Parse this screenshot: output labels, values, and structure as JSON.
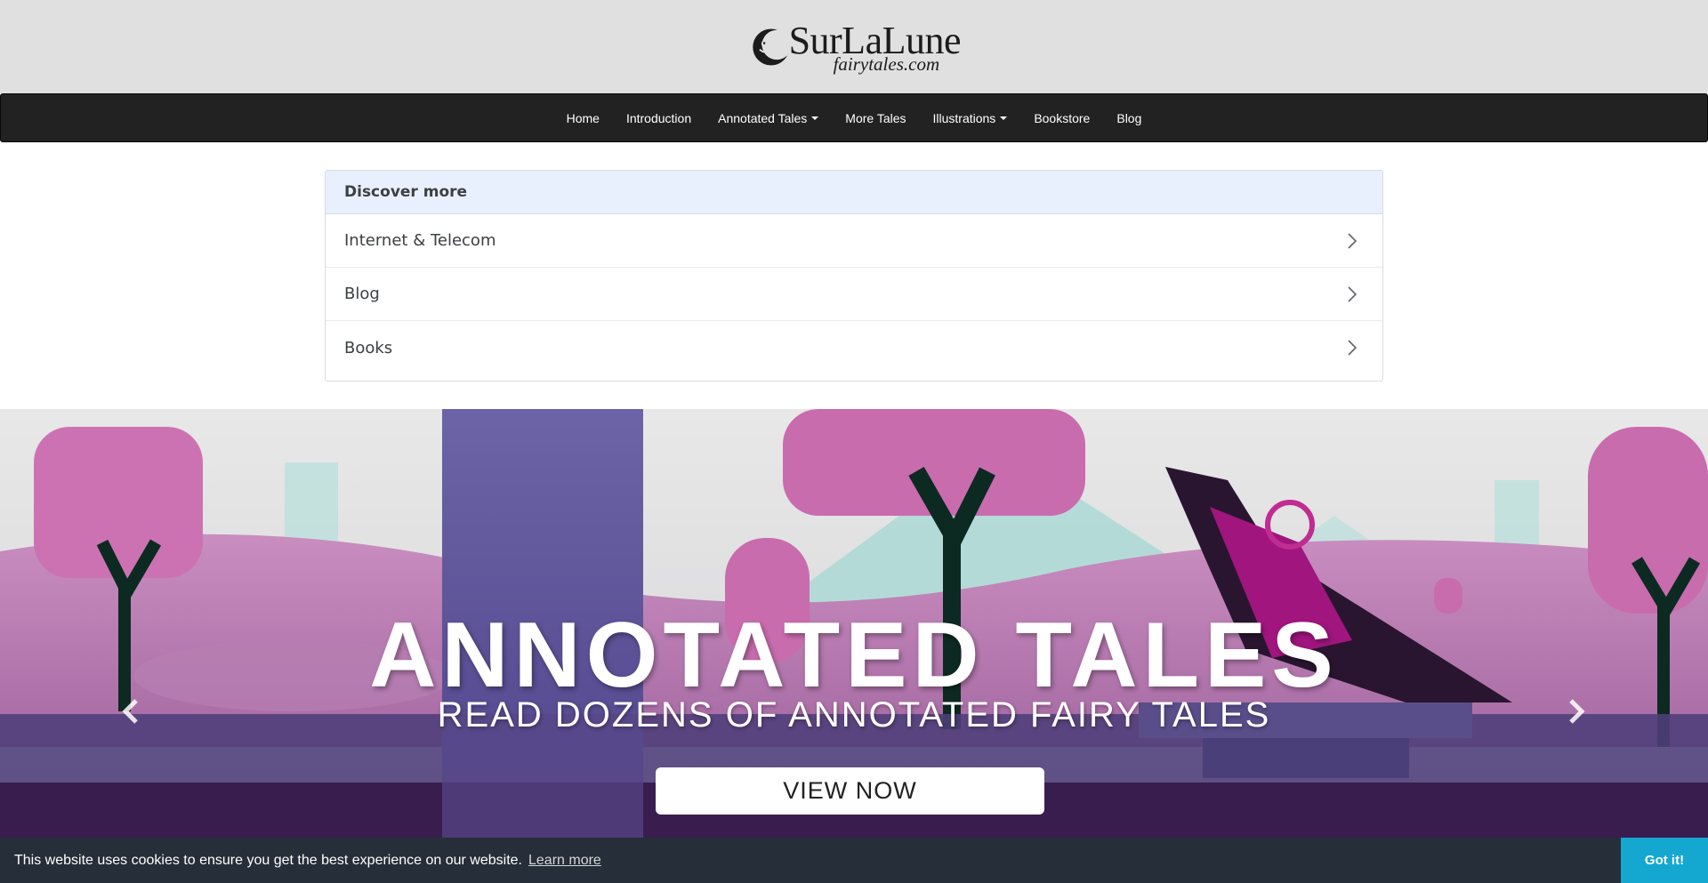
{
  "header": {
    "logo_main": "SurLaLune",
    "logo_sub": "fairytales.com"
  },
  "nav": {
    "items": [
      {
        "label": "Home",
        "dropdown": false
      },
      {
        "label": "Introduction",
        "dropdown": false
      },
      {
        "label": "Annotated Tales",
        "dropdown": true
      },
      {
        "label": "More Tales",
        "dropdown": false
      },
      {
        "label": "Illustrations",
        "dropdown": true
      },
      {
        "label": "Bookstore",
        "dropdown": false
      },
      {
        "label": "Blog",
        "dropdown": false
      }
    ]
  },
  "discover": {
    "title": "Discover more",
    "items": [
      {
        "label": "Internet & Telecom"
      },
      {
        "label": "Blog"
      },
      {
        "label": "Books"
      }
    ]
  },
  "hero": {
    "title": "ANNOTATED TALES",
    "subtitle": "READ DOZENS OF ANNOTATED FAIRY TALES",
    "button_label": "VIEW NOW",
    "prev_icon": "chevron-left-icon",
    "next_icon": "chevron-right-icon"
  },
  "cookie": {
    "message": "This website uses cookies to ensure you get the best experience on our website.",
    "learn_more": "Learn more",
    "accept": "Got it!"
  },
  "colors": {
    "header_bg": "#e0e0e0",
    "navbar_bg": "#222222",
    "discover_head_bg": "#e8f0fe",
    "cookie_bg": "#252e39",
    "cookie_button": "#14a7d0",
    "hero_pink": "#c97ab5",
    "hero_purple": "#6b5c9e"
  }
}
